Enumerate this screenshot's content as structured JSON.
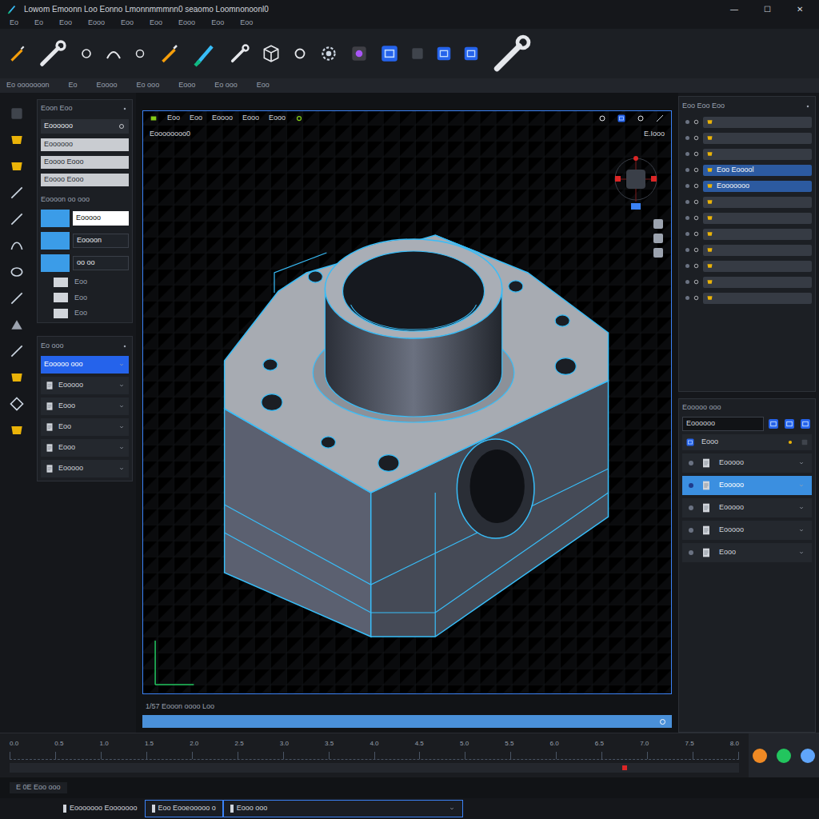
{
  "window": {
    "title": "Lowom  Emoonn  Loo Eonno  Lmonnmmmnn0  seaomo  Loomnonoonl0",
    "controls": [
      "—",
      "☐",
      "✕"
    ]
  },
  "menu": [
    "Eo",
    "Eo",
    "Eoo",
    "Eooo",
    "Eoo",
    "Eoo",
    "Eooo",
    "Eoo",
    "Eoo"
  ],
  "secondary_bar": [
    "Eo ooooooon",
    "Eo",
    "Eoooo",
    "Eo ooo",
    "Eooo",
    "Eo ooo",
    "Eoo"
  ],
  "left_panel": {
    "header": "Eoon  Eoo",
    "search": "Eoooooo",
    "fields": [
      "Eoooooo",
      "Eoooo Eooo",
      "Eoooo Eooo"
    ],
    "subheader": "Eoooon oo ooo",
    "items": [
      {
        "label": "Eooooo",
        "selected": true
      },
      {
        "label": "Eoooon",
        "selected": true
      },
      {
        "label": "oo  oo",
        "selected": true
      }
    ],
    "checks": [
      {
        "label": "Eoo",
        "checked": false
      },
      {
        "label": "Eoo",
        "checked": false
      },
      {
        "label": "Eoo",
        "checked": false
      }
    ]
  },
  "layers_panel": {
    "header": "Eo ooo",
    "items": [
      {
        "label": "Eooooo ooo",
        "selected": true
      },
      {
        "label": "Eooooo",
        "selected": false
      },
      {
        "label": "Eooo",
        "selected": false
      },
      {
        "label": "Eoo",
        "selected": false
      },
      {
        "label": "Eooo",
        "selected": false
      },
      {
        "label": "Eooooo",
        "selected": false
      }
    ]
  },
  "viewport": {
    "toolbar": [
      "Eoo",
      "Eoo",
      "Eoooo",
      "Eooo",
      "Eooo"
    ],
    "title": "Eoooooooo0",
    "scale": "E.Iooo",
    "footer": "1/57  Eooon oooo Loo"
  },
  "tree": {
    "header": "Eoo Eoo Eoo",
    "rows": [
      {
        "label": "",
        "selected": false
      },
      {
        "label": "",
        "selected": false
      },
      {
        "label": "",
        "selected": false
      },
      {
        "label": "Eoo Eooool",
        "selected": true
      },
      {
        "label": "Eooooooo",
        "selected": true
      },
      {
        "label": "",
        "selected": false
      },
      {
        "label": "",
        "selected": false
      },
      {
        "label": "",
        "selected": false
      },
      {
        "label": "",
        "selected": false
      },
      {
        "label": "",
        "selected": false
      },
      {
        "label": "",
        "selected": false
      },
      {
        "label": "",
        "selected": false
      }
    ]
  },
  "properties": {
    "header": "Eooooo  ooo",
    "field": "Eoooooo",
    "title": "Eooo",
    "rows": [
      {
        "label": "Eooooo",
        "selected": false
      },
      {
        "label": "Eooooo",
        "selected": true
      },
      {
        "label": "Eooooo",
        "selected": false
      },
      {
        "label": "Eooooo",
        "selected": false
      },
      {
        "label": "Eooo",
        "selected": false
      }
    ]
  },
  "timeline": {
    "ticks": [
      "0.0",
      "0.5",
      "1.0",
      "1.5",
      "2.0",
      "2.5",
      "3.0",
      "3.5",
      "4.0",
      "4.5",
      "5.0",
      "5.5",
      "6.0",
      "6.5",
      "7.0",
      "7.5",
      "8.0"
    ],
    "buttons": [
      {
        "color": "#f08a24"
      },
      {
        "color": "#22c55e"
      },
      {
        "color": "#60a5fa"
      }
    ]
  },
  "status": {
    "left": "E 0E   Eoo ooo",
    "fields": [
      {
        "label": "Eooooooo Eooooooo",
        "selected": false
      },
      {
        "label": "Eoo Eooeooooo o",
        "selected": true
      },
      {
        "label": "Eooo ooo",
        "selected": true
      }
    ]
  }
}
